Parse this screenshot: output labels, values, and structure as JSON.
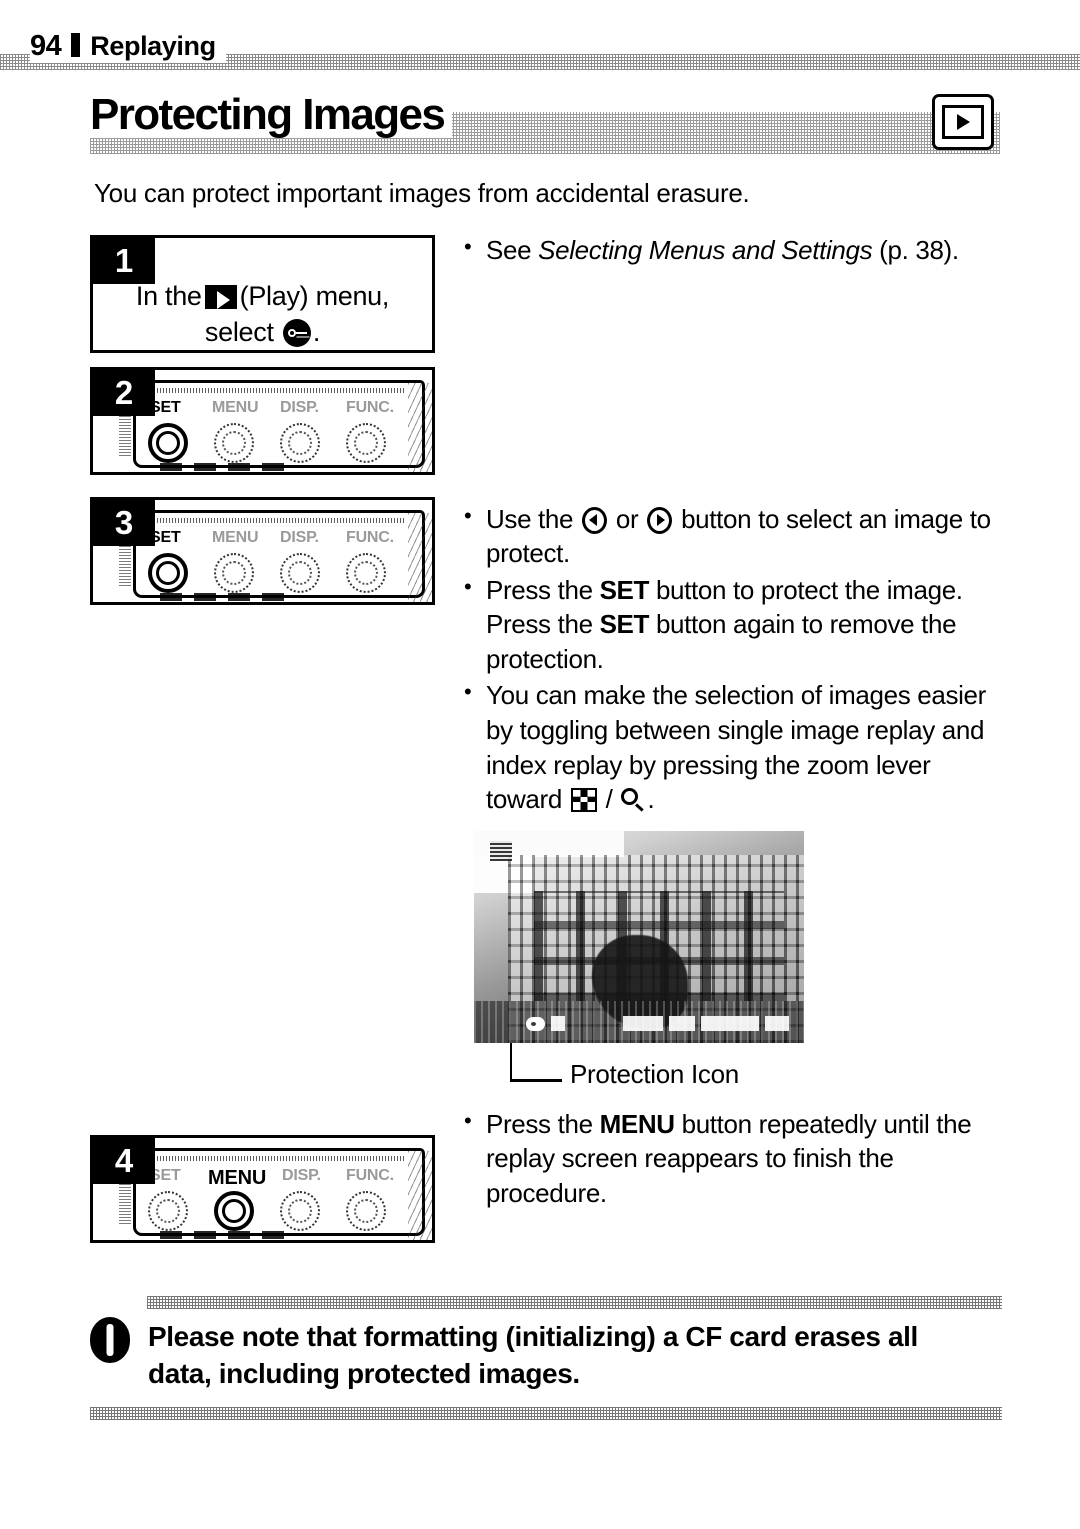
{
  "running_head": {
    "page_number": "94",
    "chapter": "Replaying"
  },
  "section": {
    "title": "Protecting Images",
    "mode_icon": "play-mode-icon",
    "intro": "You can protect important images from accidental erasure."
  },
  "steps": [
    {
      "number": "1",
      "kind": "instruction",
      "line1_before": "In the",
      "line1_icon": "play-icon",
      "line1_after": "(Play) menu,",
      "line2_before": "select",
      "line2_icon": "protect-key-icon",
      "line2_after": "."
    },
    {
      "number": "2",
      "kind": "camera-illustration",
      "buttons": [
        "SET",
        "MENU",
        "DISP.",
        "FUNC."
      ],
      "active_button": "SET"
    },
    {
      "number": "3",
      "kind": "camera-illustration",
      "buttons": [
        "SET",
        "MENU",
        "DISP.",
        "FUNC."
      ],
      "active_button": "SET"
    },
    {
      "number": "4",
      "kind": "camera-illustration",
      "buttons": [
        "SET",
        "MENU",
        "DISP.",
        "FUNC."
      ],
      "active_button": "MENU"
    }
  ],
  "bullets": {
    "step1": {
      "prefix": "See ",
      "italic": "Selecting Menus and Settings",
      "suffix": " (p. 38)."
    },
    "select_image": {
      "p1": "Use the ",
      "icon_left": "left-arrow-button-icon",
      "p2": " or ",
      "icon_right": "right-arrow-button-icon",
      "p3": " button to select an image to protect."
    },
    "press_set": {
      "p1": "Press the ",
      "b1": "SET",
      "p2": " button to protect the image. Press the ",
      "b2": "SET",
      "p3": " button again to remove the protection."
    },
    "toggle_index": {
      "p1": "You can make the selection of images easier by toggling between single image replay and index replay by pressing the zoom lever toward ",
      "icon_index": "index-replay-icon",
      "p2": " / ",
      "icon_magnify": "magnify-icon",
      "p3": "."
    },
    "press_menu": {
      "p1": "Press the ",
      "b1": "MENU",
      "p2": " button repeatedly until the replay screen reappears to finish the procedure."
    }
  },
  "lcd": {
    "callout_label": "Protection Icon",
    "osd_key_icon": "protection-key-icon"
  },
  "note": {
    "icon": "caution-icon",
    "line1": "Please note that formatting (initializing) a CF card erases all",
    "line2": "data, including protected images."
  }
}
